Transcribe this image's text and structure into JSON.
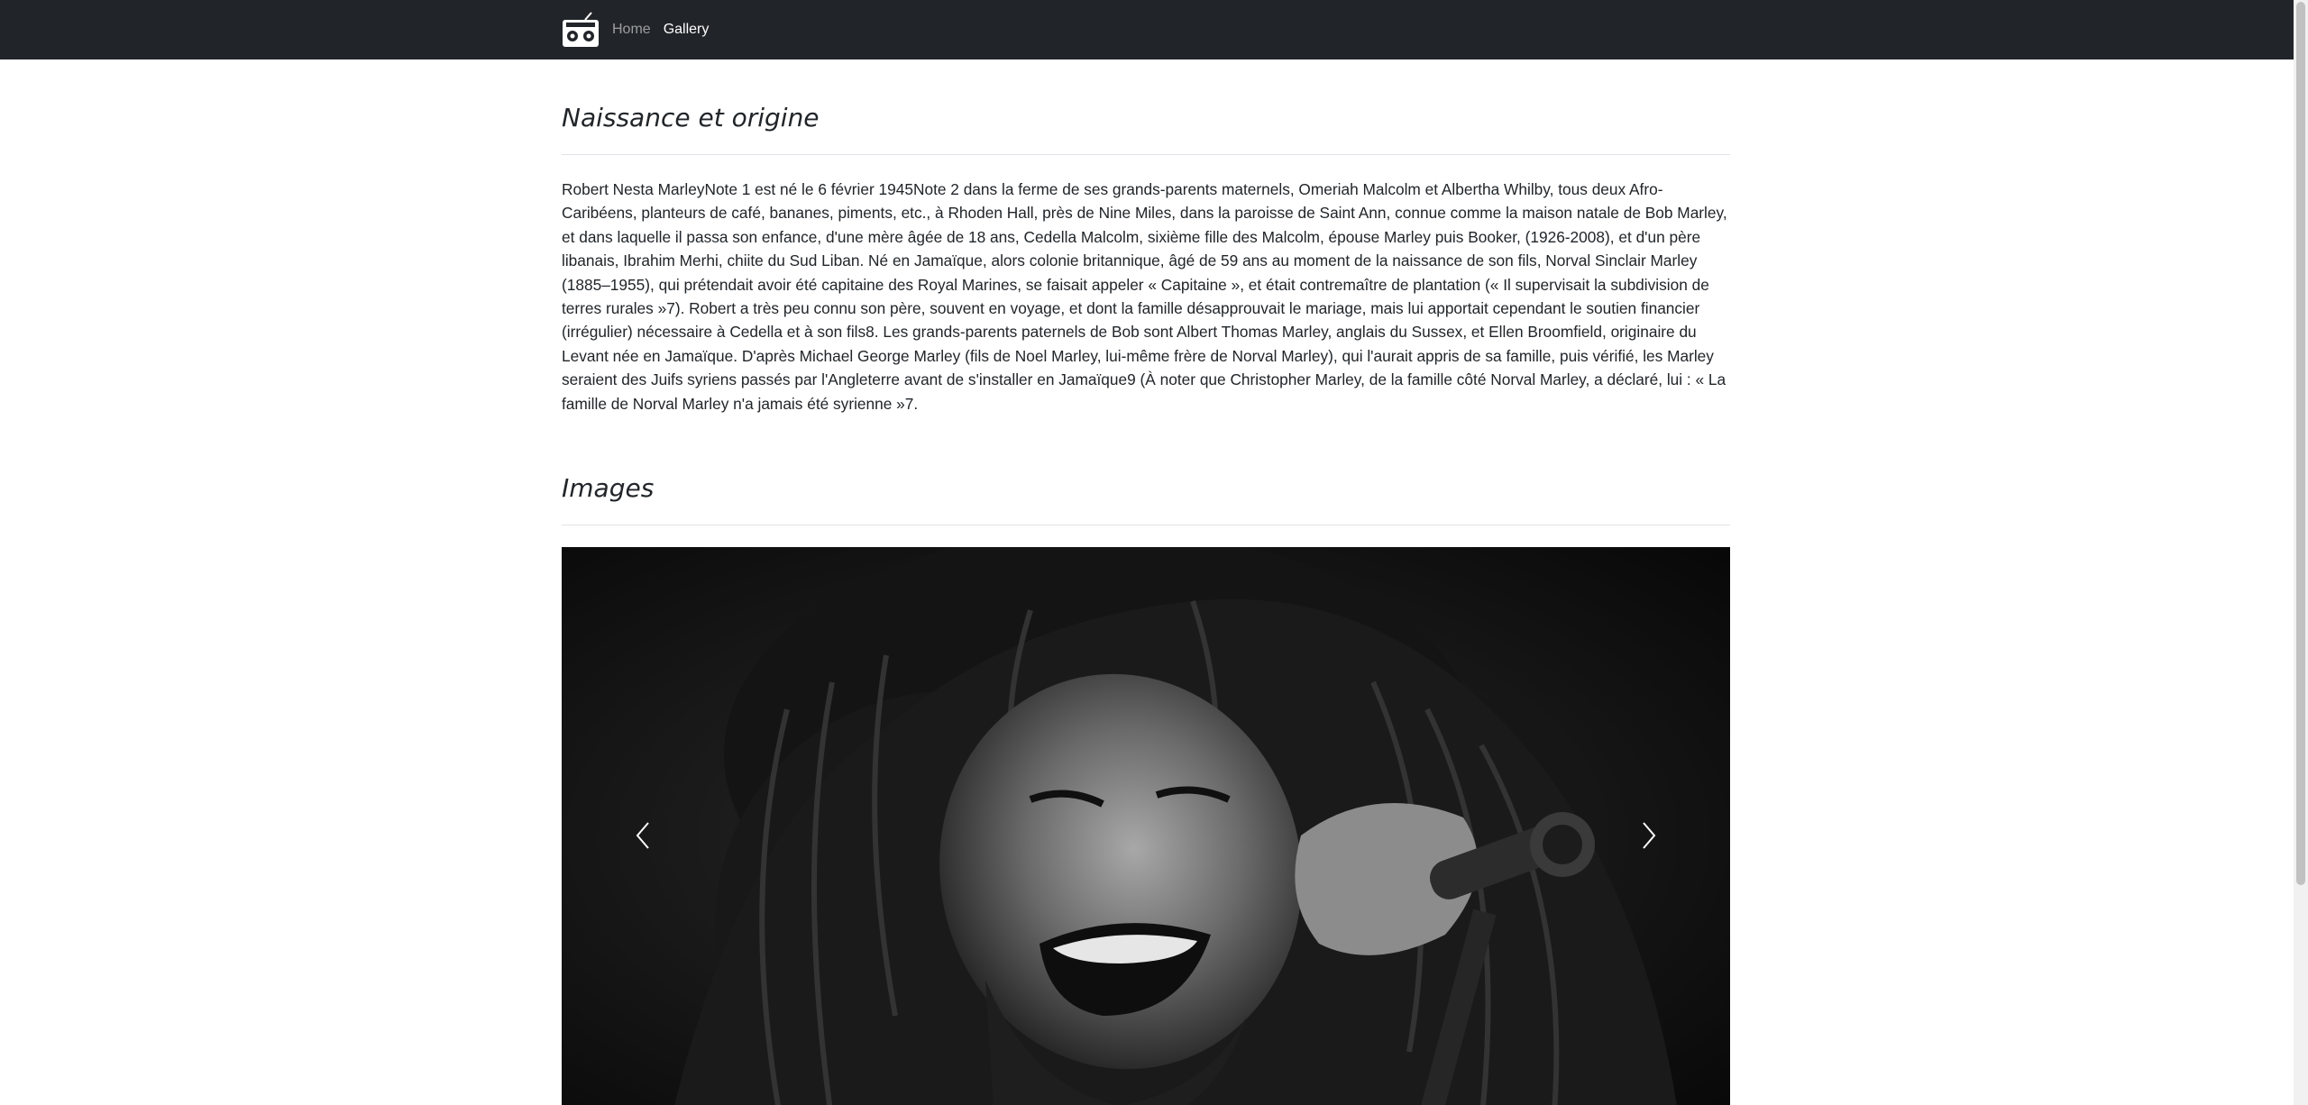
{
  "navbar": {
    "brand_icon": "radio-icon",
    "links": [
      {
        "label": "Home",
        "active": false
      },
      {
        "label": "Gallery",
        "active": true
      }
    ]
  },
  "sections": {
    "origin": {
      "title": "Naissance et origine",
      "text": "Robert Nesta MarleyNote 1 est né le 6 février 1945Note 2 dans la ferme de ses grands-parents maternels, Omeriah Malcolm et Albertha Whilby, tous deux Afro-Caribéens, planteurs de café, bananes, piments, etc., à Rhoden Hall, près de Nine Miles, dans la paroisse de Saint Ann, connue comme la maison natale de Bob Marley, et dans laquelle il passa son enfance, d'une mère âgée de 18 ans, Cedella Malcolm, sixième fille des Malcolm, épouse Marley puis Booker, (1926-2008), et d'un père libanais, Ibrahim Merhi, chiite du Sud Liban. Né en Jamaïque, alors colonie britannique, âgé de 59 ans au moment de la naissance de son fils, Norval Sinclair Marley (1885–1955), qui prétendait avoir été capitaine des Royal Marines, se faisait appeler « Capitaine », et était contremaître de plantation (« Il supervisait la subdivision de terres rurales »7). Robert a très peu connu son père, souvent en voyage, et dont la famille désapprouvait le mariage, mais lui apportait cependant le soutien financier (irrégulier) nécessaire à Cedella et à son fils8. Les grands-parents paternels de Bob sont Albert Thomas Marley, anglais du Sussex, et Ellen Broomfield, originaire du Levant née en Jamaïque. D'après Michael George Marley (fils de Noel Marley, lui-même frère de Norval Marley), qui l'aurait appris de sa famille, puis vérifié, les Marley seraient des Juifs syriens passés par l'Angleterre avant de s'installer en Jamaïque9 (À noter que Christopher Marley, de la famille côté Norval Marley, a déclaré, lui : « La famille de Norval Marley n'a jamais été syrienne »7."
    },
    "images": {
      "title": "Images",
      "carousel": {
        "prev_icon": "chevron-left-icon",
        "next_icon": "chevron-right-icon"
      }
    }
  },
  "colors": {
    "navbar_bg": "#212529",
    "nav_inactive": "rgba(255,255,255,0.55)",
    "nav_active": "#ffffff",
    "text": "#212529",
    "divider": "#dee2e6"
  }
}
